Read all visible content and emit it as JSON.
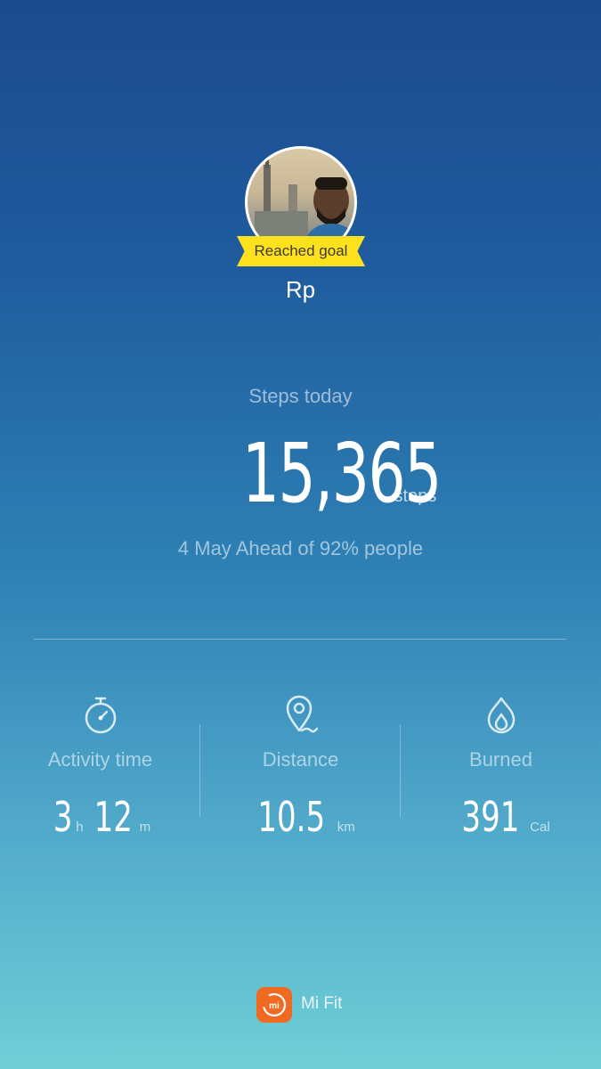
{
  "profile": {
    "name": "Rp",
    "badge": "Reached goal"
  },
  "steps": {
    "label": "Steps today",
    "value": "15,365",
    "unit": "steps",
    "ranking": "4 May Ahead of 92% people"
  },
  "stats": {
    "activity": {
      "icon": "stopwatch-icon",
      "label": "Activity time",
      "hours": "3",
      "hours_unit": "h",
      "minutes": "12",
      "minutes_unit": "m"
    },
    "distance": {
      "icon": "location-pin-icon",
      "label": "Distance",
      "value": "10.5",
      "unit": "km"
    },
    "burned": {
      "icon": "flame-icon",
      "label": "Burned",
      "value": "391",
      "unit": "Cal"
    }
  },
  "footer": {
    "app_name": "Mi Fit",
    "logo_text": "mi"
  },
  "colors": {
    "badge_yellow": "#ffe11e",
    "brand_orange": "#f26a21"
  }
}
